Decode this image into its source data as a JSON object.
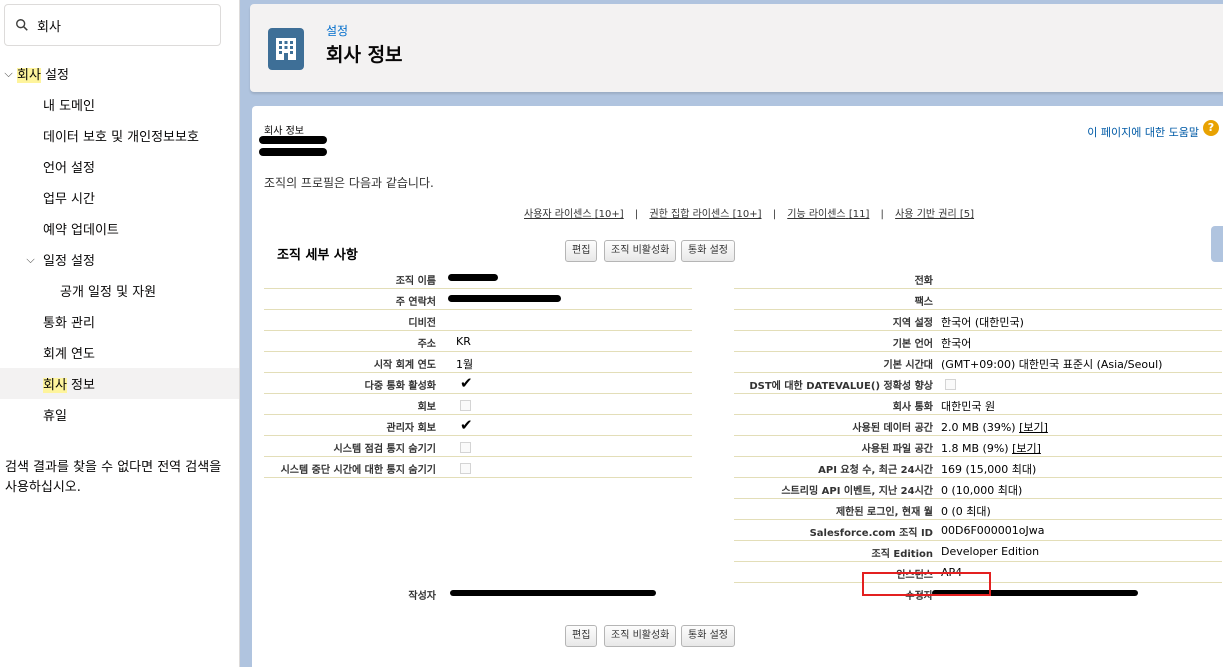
{
  "search": {
    "value": "회사",
    "placeholder": ""
  },
  "sidebar": {
    "items": [
      {
        "label_hl": "회사",
        "label_rest": " 설정"
      },
      {
        "label": "내 도메인"
      },
      {
        "label": "데이터 보호 및 개인정보보호"
      },
      {
        "label": "언어 설정"
      },
      {
        "label": "업무 시간"
      },
      {
        "label": "예약 업데이트"
      },
      {
        "label": "일정 설정"
      },
      {
        "label": "공개 일정 및 자원"
      },
      {
        "label": "통화 관리"
      },
      {
        "label": "회계 연도"
      },
      {
        "label_hl": "회사",
        "label_rest": " 정보"
      },
      {
        "label": "휴일"
      }
    ],
    "note": "검색 결과를 찾을 수 없다면 전역 검색을 사용하십시오."
  },
  "header": {
    "crumb": "설정",
    "title": "회사 정보"
  },
  "content": {
    "subtitle": "회사 정보",
    "help_link": "이 페이지에 대한 도움말",
    "help_icon_label": "?",
    "profile_text": "조직의 프로필은 다음과 같습니다.",
    "licenses": [
      {
        "label": "사용자 라이센스",
        "count": "[10+]"
      },
      {
        "label": "권한 집합 라이센스",
        "count": "[10+]"
      },
      {
        "label": "기능 라이센스",
        "count": "[11]"
      },
      {
        "label": "사용 기반 권리",
        "count": "[5]"
      }
    ],
    "separator": "|",
    "section_title": "조직 세부 사항",
    "buttons": {
      "edit": "편집",
      "deactivate": "조직 비활성화",
      "currency": "통화 설정"
    }
  },
  "details": {
    "left": [
      {
        "label": "조직 이름",
        "value": ""
      },
      {
        "label": "주 연락처",
        "value": ""
      },
      {
        "label": "디비전",
        "value": ""
      },
      {
        "label": "주소",
        "value": "KR"
      },
      {
        "label": "시작 회계 연도",
        "value": "1월"
      },
      {
        "label": "다중 통화 활성화",
        "checked": true
      },
      {
        "label": "회보",
        "checked": false
      },
      {
        "label": "관리자 회보",
        "checked": true
      },
      {
        "label": "시스템 점검 통지 숨기기",
        "checked": false
      },
      {
        "label": "시스템 중단 시간에 대한 통지 숨기기",
        "checked": false
      }
    ],
    "right": [
      {
        "label": "전화",
        "value": ""
      },
      {
        "label": "팩스",
        "value": ""
      },
      {
        "label": "지역 설정",
        "value": "한국어 (대한민국)"
      },
      {
        "label": "기본 언어",
        "value": "한국어"
      },
      {
        "label": "기본 시간대",
        "value": "(GMT+09:00) 대한민국 표준시 (Asia/Seoul)"
      },
      {
        "label": "DST에 대한 DATEVALUE() 정확성 향상",
        "checked": false
      },
      {
        "label": "회사 통화",
        "value": "대한민국 원"
      },
      {
        "label": "사용된 데이터 공간",
        "value": "2.0 MB (39%)",
        "link": "[보기]"
      },
      {
        "label": "사용된 파일 공간",
        "value": "1.8 MB (9%)",
        "link": "[보기]"
      },
      {
        "label": "API 요청 수, 최근 24시간",
        "value": "169 (15,000 최대)"
      },
      {
        "label": "스트리밍 API 이벤트, 지난 24시간",
        "value": "0 (10,000 최대)"
      },
      {
        "label": "제한된 로그인, 현재 월",
        "value": "0 (0 최대)"
      },
      {
        "label": "Salesforce.com 조직 ID",
        "value": "00D6F000001oJwa"
      },
      {
        "label": "조직 Edition",
        "value": "Developer Edition"
      },
      {
        "label": "인스턴스",
        "value": "AP4"
      }
    ],
    "created_by_label": "작성자",
    "modified_by_label": "수정자"
  }
}
